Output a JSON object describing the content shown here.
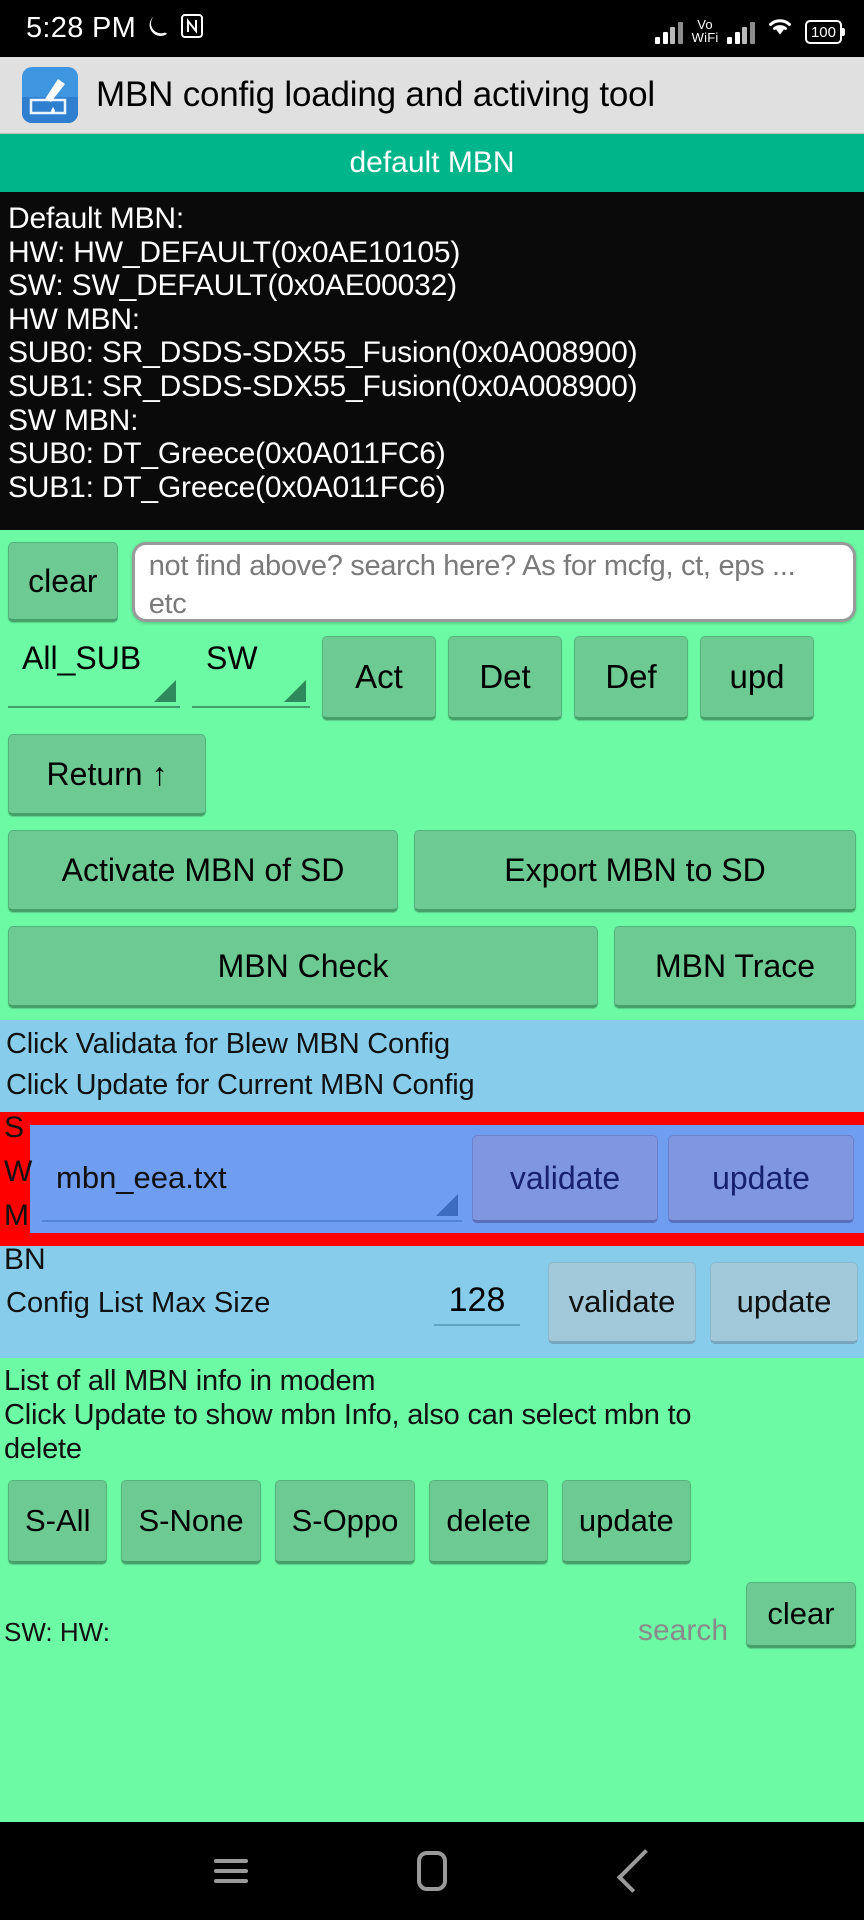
{
  "statusbar": {
    "time": "5:28 PM",
    "moon_icon": "do-not-disturb-moon-icon",
    "nfc_icon": "nfc-icon",
    "vowifi_line1": "Vo",
    "vowifi_line2": "WiFi",
    "signal_icon": "cellular-signal-icon",
    "signal2_icon": "cellular-signal-icon",
    "wifi_icon": "wifi-icon",
    "battery_level": "100"
  },
  "titlebar": {
    "app_icon": "mbn-tool-app-icon",
    "title": "MBN config loading and activing tool"
  },
  "teal_header": {
    "label": "default MBN",
    "color": "#00b58a"
  },
  "info_panel": {
    "lines": [
      "Default MBN:",
      "HW: HW_DEFAULT(0x0AE10105)",
      "SW: SW_DEFAULT(0x0AE00032)",
      "HW MBN:",
      "SUB0: SR_DSDS-SDX55_Fusion(0x0A008900)",
      "SUB1: SR_DSDS-SDX55_Fusion(0x0A008900)",
      "SW MBN:",
      "SUB0: DT_Greece(0x0A011FC6)",
      "SUB1: DT_Greece(0x0A011FC6)"
    ]
  },
  "search_row": {
    "clear_label": "clear",
    "placeholder": "not find above? search here? As for mcfg, ct, eps ... etc",
    "value": ""
  },
  "spinner_row": {
    "sub_selected": "All_SUB",
    "type_selected": "SW",
    "buttons": [
      "Act",
      "Det",
      "Def",
      "upd"
    ]
  },
  "return_row": {
    "label": "Return ↑"
  },
  "sd_row": {
    "activate_label": "Activate MBN of SD",
    "export_label": "Export MBN to SD"
  },
  "check_row": {
    "check_label": "MBN Check",
    "trace_label": "MBN Trace"
  },
  "blue_section": {
    "note_line1": "Click Validata for Blew MBN Config",
    "note_line2": "Click Update for Current MBN Config",
    "behind_chars": [
      "S",
      "W",
      "M",
      "BN"
    ],
    "file_selected": "mbn_eea.txt",
    "file_validate_label": "validate",
    "file_update_label": "update",
    "highlight_color": "#ff0000",
    "maxsize_label": "Config List Max Size",
    "maxsize_value": "128",
    "maxsize_validate_label": "validate",
    "maxsize_update_label": "update"
  },
  "bottom_section": {
    "note_line1": "List of all MBN info in modem",
    "note_line2": " Click Update to show mbn Info, also can select mbn to",
    "note_line3": "delete",
    "buttons": [
      "S-All",
      "S-None",
      "S-Oppo",
      "delete",
      "update"
    ],
    "footer_text": "SW:  HW:",
    "search_label": "search",
    "clear_label": "clear"
  },
  "navbar": {
    "recents_icon": "hamburger-recents-icon",
    "home_icon": "home-icon",
    "back_icon": "back-chevron-icon"
  }
}
